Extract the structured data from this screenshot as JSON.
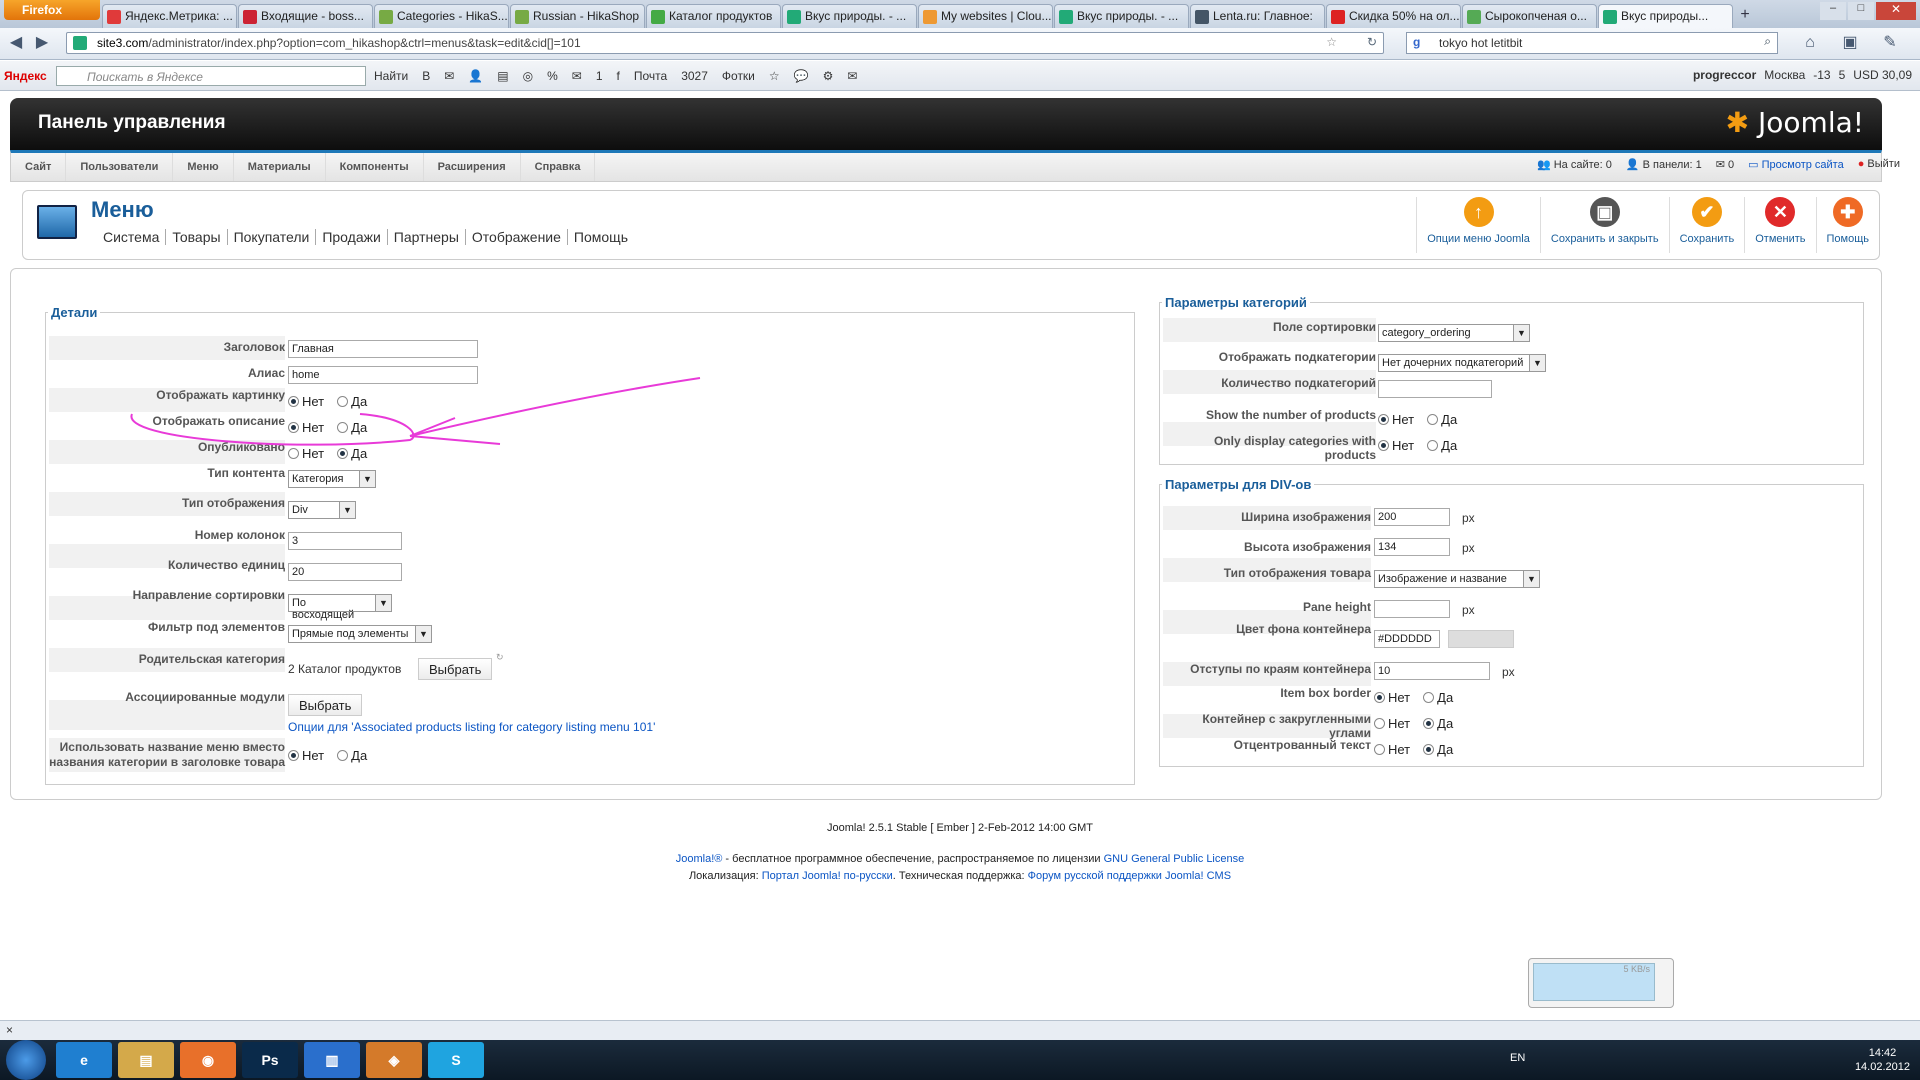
{
  "browser": {
    "menu_button": "Firefox",
    "tabs": [
      {
        "title": "Яндекс.Метрика: ...",
        "color": "#e03a3a"
      },
      {
        "title": "Входящие - boss...",
        "color": "#c23"
      },
      {
        "title": "Categories - HikaS...",
        "color": "#7a4"
      },
      {
        "title": "Russian - HikaShop",
        "color": "#7a4"
      },
      {
        "title": "Каталог продуктов",
        "color": "#4a4"
      },
      {
        "title": "Вкус природы. - ...",
        "color": "#2a7"
      },
      {
        "title": "My websites | Clou...",
        "color": "#e93"
      },
      {
        "title": "Вкус природы. - ...",
        "color": "#2a7"
      },
      {
        "title": "Lenta.ru: Главное:",
        "color": "#456"
      },
      {
        "title": "Скидка 50% на ол...",
        "color": "#d22"
      },
      {
        "title": "Сырокопченая о...",
        "color": "#5a5"
      },
      {
        "title": "Вкус природы...",
        "color": "#2a7",
        "active": true
      }
    ],
    "url_host": "site3.com",
    "url_path": "/administrator/index.php?option=com_hikashop&ctrl=menus&task=edit&cid[]=101",
    "search_value": "tokyo hot letitbit"
  },
  "yandex_bar": {
    "logo": "Яндекс",
    "search_placeholder": "Поискать в Яндексе",
    "find_button": "Найти",
    "items": [
      "В",
      "✉",
      "👤",
      "▤",
      "◎",
      "%",
      "✉",
      "1",
      "f",
      "Почта",
      "3027",
      "Фотки",
      "☆",
      "💬",
      "⚙",
      "✉"
    ],
    "user": "progreccor",
    "city": "Москва",
    "temp": "-13",
    "mail_count": "5",
    "currency": "USD 30,09"
  },
  "joomla": {
    "panel_title": "Панель управления",
    "logo": "Joomla!",
    "menu": [
      "Сайт",
      "Пользователи",
      "Меню",
      "Материалы",
      "Компоненты",
      "Расширения",
      "Справка"
    ],
    "status": {
      "on_site": "На сайте: 0",
      "in_panel": "В панели: 1",
      "messages": "0",
      "view_site": "Просмотр сайта",
      "logout": "Выйти"
    },
    "page_title": "Меню",
    "submenu": [
      "Система",
      "Товары",
      "Покупатели",
      "Продажи",
      "Партнеры",
      "Отображение",
      "Помощь"
    ],
    "toolbar": [
      {
        "label": "Опции меню Joomla",
        "icon": "joomla-options-icon",
        "color": "#f39c12",
        "glyph": "↑"
      },
      {
        "label": "Сохранить и закрыть",
        "icon": "save-close-icon",
        "color": "#555",
        "glyph": "▣"
      },
      {
        "label": "Сохранить",
        "icon": "save-check-icon",
        "color": "#f39c12",
        "glyph": "✔"
      },
      {
        "label": "Отменить",
        "icon": "cancel-icon",
        "color": "#e02a2a",
        "glyph": "✕"
      },
      {
        "label": "Помощь",
        "icon": "help-icon",
        "color": "#ef6a25",
        "glyph": "✚"
      }
    ]
  },
  "details": {
    "legend": "Детали",
    "title_label": "Заголовок",
    "title_value": "Главная",
    "alias_label": "Алиас",
    "alias_value": "home",
    "show_image_label": "Отображать картинку",
    "show_desc_label": "Отображать описание",
    "published_label": "Опубликовано",
    "no": "Нет",
    "yes": "Да",
    "content_type_label": "Тип контента",
    "content_type_value": "Категория",
    "display_type_label": "Тип отображения",
    "display_type_value": "Div",
    "columns_label": "Номер колонок",
    "columns_value": "3",
    "items_label": "Количество единиц",
    "items_value": "20",
    "sort_dir_label": "Направление сортировки",
    "sort_dir_value": "По восходящей",
    "filter_label": "Фильтр под элементов",
    "filter_value": "Прямые под элементы",
    "parent_label": "Родительская категория",
    "parent_value": "2 Каталог продуктов",
    "choose_button": "Выбрать",
    "assoc_label": "Ассоциированные модули",
    "assoc_button": "Выбрать",
    "assoc_link": "Опции для 'Associated products listing for category listing menu 101'",
    "use_menu_name_label_1": "Использовать название меню вместо",
    "use_menu_name_label_2": "названия категории в заголовке товара"
  },
  "category_params": {
    "legend": "Параметры категорий",
    "sort_field_label": "Поле сортировки",
    "sort_field_value": "category_ordering",
    "show_sub_label": "Отображать подкатегории",
    "show_sub_value": "Нет дочерних подкатегорий",
    "sub_count_label": "Количество подкатегорий",
    "sub_count_value": "",
    "show_num_label": "Show the number of products",
    "only_with_label": "Only display categories with products",
    "no": "Нет",
    "yes": "Да"
  },
  "div_params": {
    "legend": "Параметры для DIV-ов",
    "img_width_label": "Ширина изображения",
    "img_width_value": "200",
    "img_height_label": "Высота изображения",
    "img_height_value": "134",
    "px": "px",
    "display_label": "Тип отображения товара",
    "display_value": "Изображение и название",
    "pane_label": "Pane height",
    "pane_value": "",
    "bg_label": "Цвет фона контейнера",
    "bg_value": "#DDDDDD",
    "padding_label": "Отступы по краям контейнера",
    "padding_value": "10",
    "border_label": "Item box border",
    "rounded_label": "Контейнер с закругленными углами",
    "centered_label": "Отцентрованный текст",
    "no": "Нет",
    "yes": "Да"
  },
  "footer": {
    "version": "Joomla! 2.5.1 Stable [ Ember ] 2-Feb-2012 14:00 GMT",
    "joomla_link": "Joomla!®",
    "license_text": " - бесплатное программное обеспечение, распространяемое по лицензии ",
    "gpl_link": "GNU General Public License",
    "loc_text": "Локализация: ",
    "loc_link": "Портал Joomla! по-русски",
    "support_text": ". Техническая поддержка: ",
    "support_link": "Форум русской поддержки Joomla! CMS"
  },
  "statusbar": {
    "close": "×"
  },
  "taskbar": {
    "apps": [
      {
        "label": "e",
        "color": "#1f7fd0"
      },
      {
        "label": "▤",
        "color": "#d4a94a"
      },
      {
        "label": "◉",
        "color": "#e8702a"
      },
      {
        "label": "Ps",
        "color": "#0a2a4a"
      },
      {
        "label": "▥",
        "color": "#2a6fcc"
      },
      {
        "label": "◈",
        "color": "#d47a2a"
      },
      {
        "label": "S",
        "color": "#1fa4e0"
      }
    ],
    "lang": "EN",
    "time": "14:42",
    "date": "14.02.2012"
  },
  "net_widget": {
    "speed": "5 KB/s"
  }
}
